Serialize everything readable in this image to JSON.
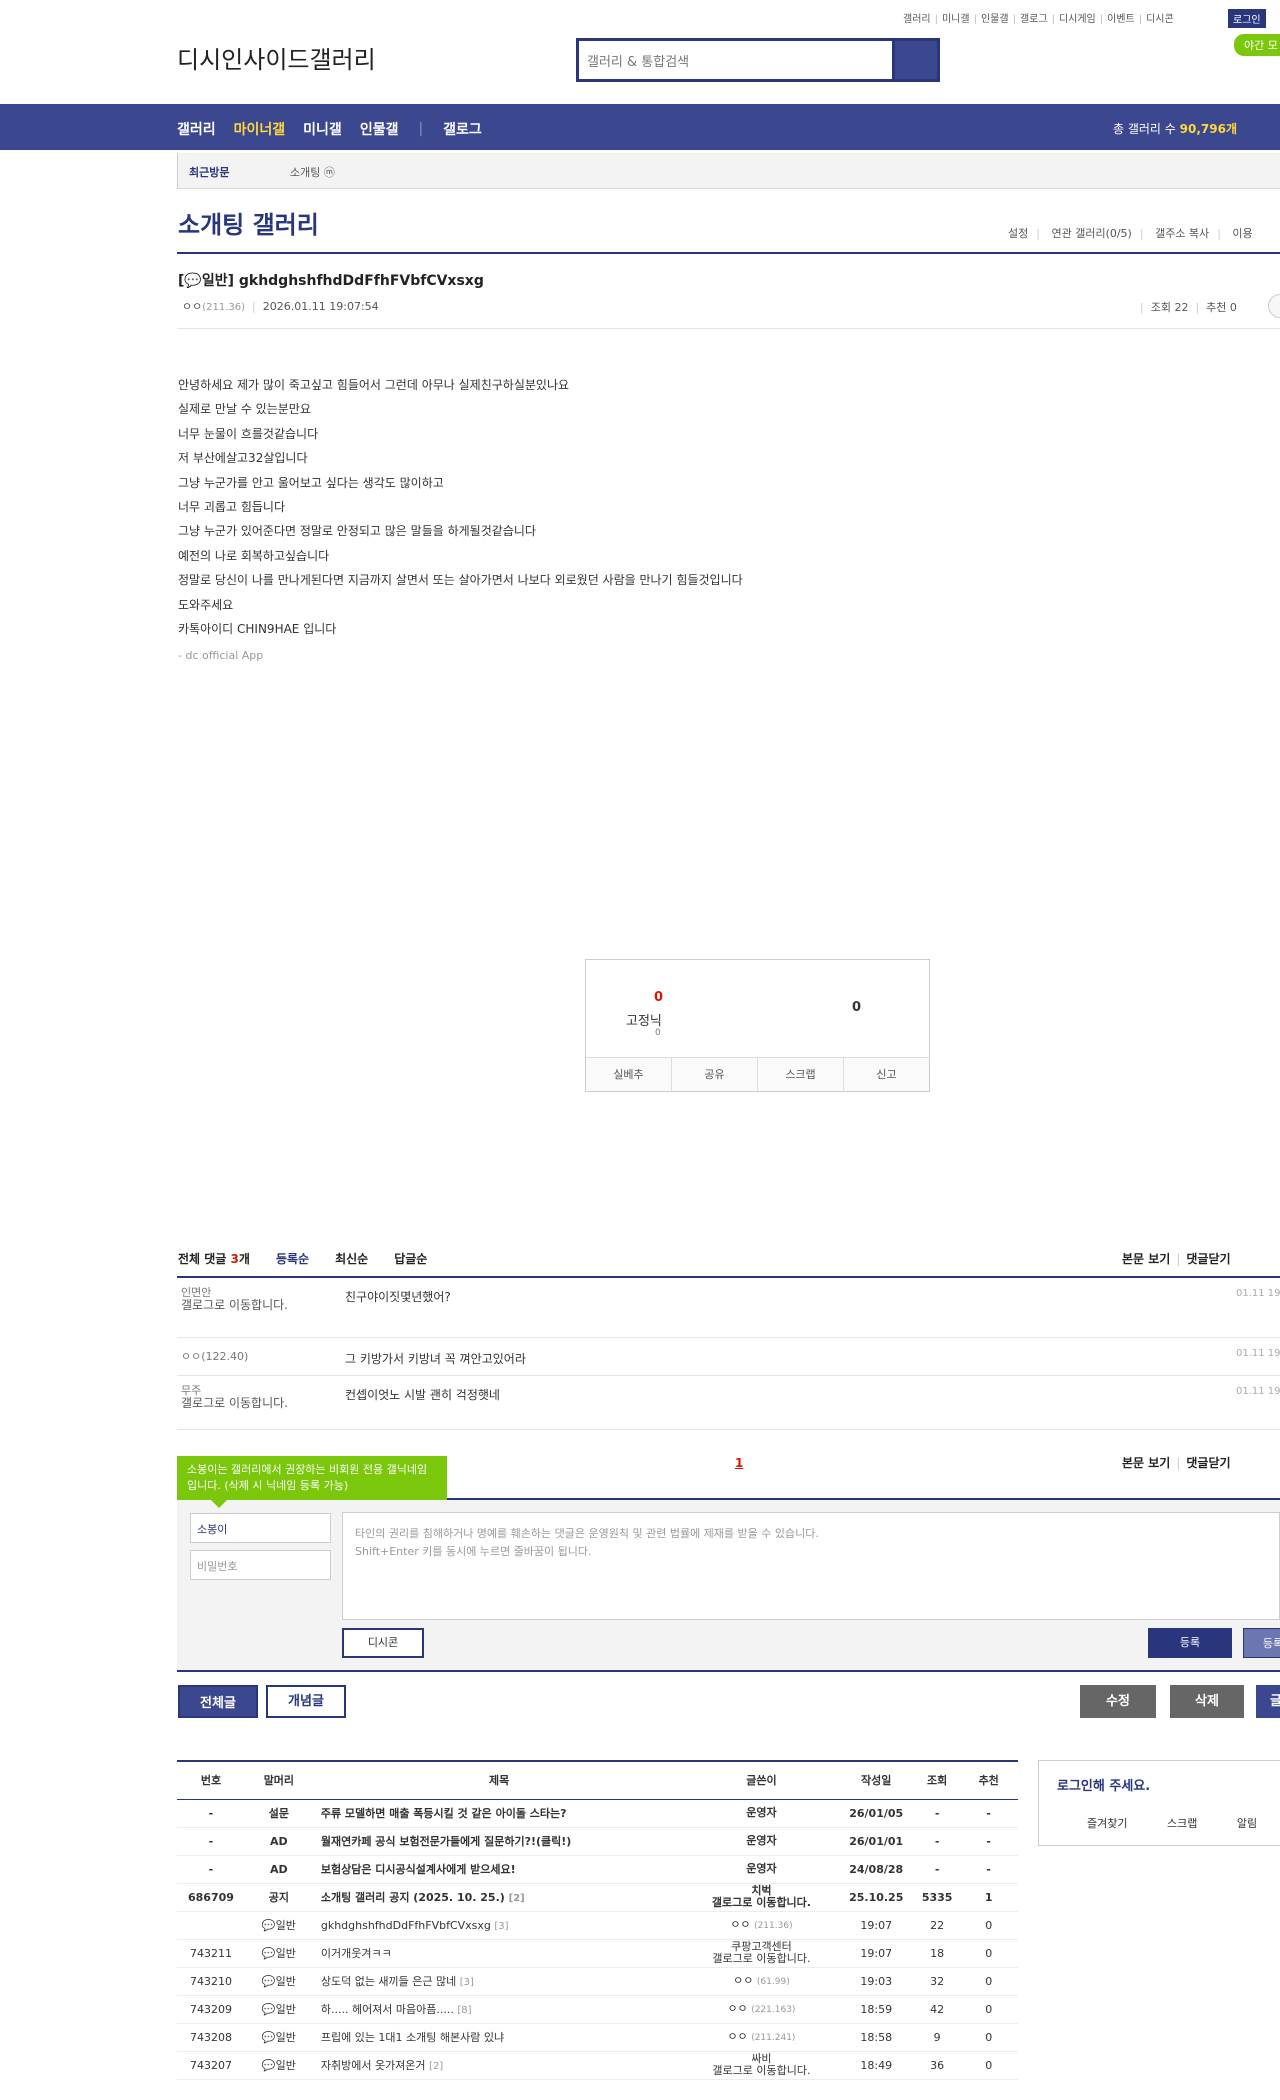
{
  "util_links": [
    "갤러리",
    "미니갤",
    "인물갤",
    "갤로그",
    "디시게임",
    "이벤트",
    "디시콘"
  ],
  "login": "로그인",
  "night_mode": "야간 모",
  "logo": "디시인사이드갤러리",
  "search": {
    "placeholder": "갤러리 & 통합검색"
  },
  "nav": {
    "items": [
      "갤러리",
      "마이너갤",
      "미니갤",
      "인물갤"
    ],
    "gallog": "갤로그",
    "count_label": "총 갤러리 수",
    "count_value": "90,796개"
  },
  "subnav": {
    "recent": "최근방문",
    "gallery": "소개팅 ⓜ"
  },
  "gallery": {
    "title": "소개팅 갤러리",
    "menu": [
      "설정",
      "연관 갤러리(0/5)",
      "갤주소 복사",
      "이용"
    ]
  },
  "post": {
    "title": "[💬일반] gkhdghshfhdDdFfhFVbfCVxsxg",
    "author": "ㅇㅇ",
    "ip": "(211.36)",
    "date": "2026.01.11 19:07:54",
    "views_label": "조회 22",
    "recommend_label": "추천 0",
    "body": [
      "안녕하세요 제가 많이 죽고싶고 힘들어서 그런데 아무나 실제친구하실분있나요",
      "실제로 만날 수 있는분만요",
      "너무 눈물이 흐를것같습니다",
      "저 부산에살고32살입니다",
      "그냥 누군가를 안고 울어보고 싶다는 생각도 많이하고",
      "너무 괴롭고 힘듭니다",
      "그냥 누군가 있어준다면 정말로 안정되고 많은 말들을 하게될것같습니다",
      "예전의 나로 회복하고싶습니다",
      "정말로 당신이 나를 만나게된다면 지금까지 살면서 또는 살아가면서 나보다 외로웠던 사람을 만나기 힘들것입니다",
      "도와주세요",
      "카톡아이디 CHIN9HAE 입니다"
    ],
    "signature": "- dc official App"
  },
  "recommend": {
    "up": "0",
    "fixed_label": "고정닉",
    "fixed_count": "0",
    "down": "0",
    "actions": [
      "실베추",
      "공유",
      "스크랩",
      "신고"
    ]
  },
  "comments": {
    "total_prefix": "전체 댓글",
    "total_count": "3",
    "total_suffix": "개",
    "sorts": [
      "등록순",
      "최신순",
      "답글순"
    ],
    "view_body": "본문 보기",
    "close": "댓글닫기",
    "items": [
      {
        "nick": "인면안",
        "img": "갤로그로 이동합니다.",
        "text": "친구야이짓몇년했어?",
        "time": "01.11 19"
      },
      {
        "nick": "ㅇㅇ(122.40)",
        "img": "",
        "text": "그 키방가서 키방녀 꼭 껴안고있어라",
        "time": "01.11 19"
      },
      {
        "nick": "무주",
        "img": "갤로그로 이동합니다.",
        "text": "컨셉이엇노 시발 괜히 걱정햇네",
        "time": "01.11 19"
      }
    ],
    "page": "1"
  },
  "write": {
    "tip": "소봉이는 갤러리에서 권장하는 비회원 전용 갤닉네임입니다. (삭제 시 닉네임 등록 가능)",
    "nick": "소봉이",
    "pw_placeholder": "비밀번호",
    "notice1": "타인의 권리를 침해하거나 명예를 훼손하는 댓글은 운영원칙 및 관련 법률에 제재를 받을 수 있습니다.",
    "notice2": "Shift+Enter 키를 동시에 누르면 줄바꿈이 됩니다.",
    "dccon": "디시콘",
    "register": "등록",
    "register2": "등록"
  },
  "buttons": {
    "all": "전체글",
    "best": "개념글",
    "edit": "수정",
    "delete": "삭제",
    "write": "글"
  },
  "list": {
    "headers": [
      "번호",
      "말머리",
      "제목",
      "글쓴이",
      "작성일",
      "조회",
      "추천"
    ],
    "rows": [
      {
        "no": "-",
        "head": "설문",
        "title": "주류 모델하면 매출 폭등시킬 것 같은 아이돌 스타는?",
        "cc": "",
        "writer": "운영자",
        "wimg": "",
        "date": "26/01/05",
        "views": "-",
        "rec": "-",
        "notice": true
      },
      {
        "no": "-",
        "head": "AD",
        "title": "월재연카페 공식 보험전문가들에게 질문하기?!(클릭!)",
        "cc": "",
        "writer": "운영자",
        "wimg": "",
        "date": "26/01/01",
        "views": "-",
        "rec": "-",
        "notice": true
      },
      {
        "no": "-",
        "head": "AD",
        "title": "보험상담은 디시공식설계사에게 받으세요!",
        "cc": "",
        "writer": "운영자",
        "wimg": "",
        "date": "24/08/28",
        "views": "-",
        "rec": "-",
        "notice": true
      },
      {
        "no": "686709",
        "head": "공지",
        "title": "소개팅 갤러리 공지 (2025. 10. 25.)",
        "cc": "[2]",
        "writer": "치벅",
        "wimg": "갤로그로 이동합니다.",
        "date": "25.10.25",
        "views": "5335",
        "rec": "1",
        "notice": true
      },
      {
        "no": "",
        "head": "💬일반",
        "title": "gkhdghshfhdDdFfhFVbfCVxsxg",
        "cc": "[3]",
        "writer": "ㅇㅇ",
        "wip": "(211.36)",
        "wimg": "",
        "date": "19:07",
        "views": "22",
        "rec": "0",
        "notice": false
      },
      {
        "no": "743211",
        "head": "💬일반",
        "title": "이거개웃겨ㅋㅋ",
        "cc": "",
        "writer": "쿠팡고객센터",
        "wimg": "갤로그로 이동합니다.",
        "date": "19:07",
        "views": "18",
        "rec": "0",
        "notice": false
      },
      {
        "no": "743210",
        "head": "💬일반",
        "title": "상도덕 없는 새끼들 은근 많네",
        "cc": "[3]",
        "writer": "ㅇㅇ",
        "wip": "(61.99)",
        "wimg": "",
        "date": "19:03",
        "views": "32",
        "rec": "0",
        "notice": false
      },
      {
        "no": "743209",
        "head": "💬일반",
        "title": "하..... 헤어져서 마음아픔.....",
        "cc": "[8]",
        "writer": "ㅇㅇ",
        "wip": "(221.163)",
        "wimg": "",
        "date": "18:59",
        "views": "42",
        "rec": "0",
        "notice": false
      },
      {
        "no": "743208",
        "head": "💬일반",
        "title": "프립에 있는 1대1 소개팅 해본사람 있냐",
        "cc": "",
        "writer": "ㅇㅇ",
        "wip": "(211.241)",
        "wimg": "",
        "date": "18:58",
        "views": "9",
        "rec": "0",
        "notice": false
      },
      {
        "no": "743207",
        "head": "💬일반",
        "title": "자취방에서 옷가져온거",
        "cc": "[2]",
        "writer": "싸비",
        "wimg": "갤로그로 이동합니다.",
        "date": "18:49",
        "views": "36",
        "rec": "0",
        "notice": false
      }
    ]
  },
  "side": {
    "title": "로그인해 주세요.",
    "actions": [
      "즐겨찾기",
      "스크랩",
      "알림"
    ]
  }
}
